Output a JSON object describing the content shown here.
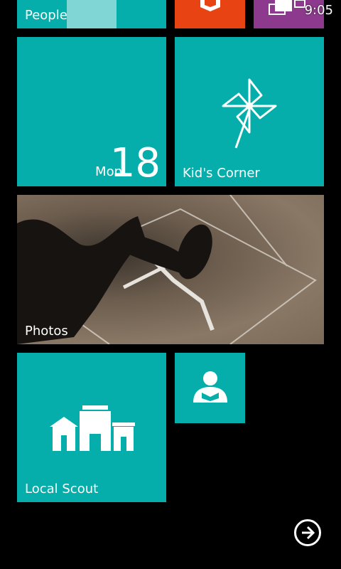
{
  "status": {
    "time": "9:05"
  },
  "tiles": {
    "people": {
      "label": "People"
    },
    "calendar": {
      "day": "Mon",
      "date": "18"
    },
    "kids_corner": {
      "label": "Kid's Corner"
    },
    "photos": {
      "label": "Photos"
    },
    "local_scout": {
      "label": "Local Scout"
    }
  },
  "colors": {
    "accent": "#05aeaa",
    "office": "#e84413",
    "messaging": "#8d3a8e",
    "background": "#000000"
  },
  "icons": {
    "office_tile": "office-icon",
    "messaging_tile": "messaging-icon",
    "kids_corner": "pinwheel-icon",
    "local_scout": "buildings-icon",
    "small_tile": "reader-icon",
    "app_list": "arrow-right-circle-icon"
  }
}
